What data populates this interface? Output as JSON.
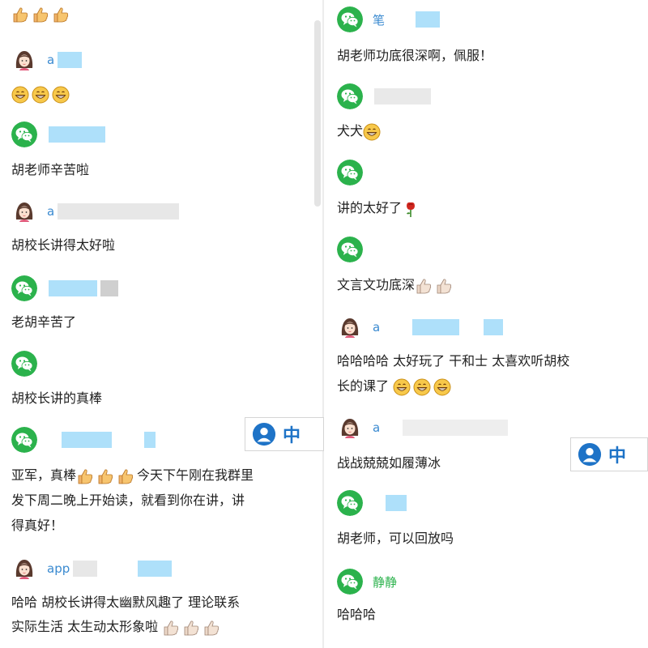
{
  "left_column": {
    "top_reaction": {
      "emoji": [
        "thumbs-up-icon",
        "thumbs-up-icon",
        "thumbs-up-icon"
      ]
    },
    "messages": [
      {
        "avatar": "girl-avatar-icon",
        "name": "a",
        "text": "",
        "emoji": [
          "grin-emoji-icon",
          "grin-emoji-icon",
          "grin-emoji-icon"
        ]
      },
      {
        "avatar": "wechat-avatar-icon",
        "name": "",
        "text": "胡老师辛苦啦"
      },
      {
        "avatar": "girl-avatar-icon",
        "name": "a",
        "text": "胡校长讲得太好啦"
      },
      {
        "avatar": "wechat-avatar-icon",
        "name": "",
        "text": "老胡辛苦了"
      },
      {
        "avatar": "wechat-avatar-icon",
        "name": "",
        "text": "胡校长讲的真棒"
      },
      {
        "avatar": "wechat-avatar-icon",
        "name": "",
        "text_before": "亚军，真棒",
        "text_after": "今天下午刚在我群里",
        "text_line2": "发下周二晚上开始读，就看到你在讲，讲",
        "text_line3": "得真好！"
      },
      {
        "avatar": "girl-avatar-icon",
        "name": "app",
        "text_line1": "哈哈 胡校长讲得太幽默风趣了 理论联系",
        "text_line2": "实际生活 太生动太形象啦"
      }
    ]
  },
  "right_column": {
    "messages": [
      {
        "avatar": "wechat-avatar-icon",
        "name": "笔",
        "text": "胡老师功底很深啊，佩服！"
      },
      {
        "avatar": "wechat-avatar-icon",
        "name": "",
        "text": "犬犬"
      },
      {
        "avatar": "wechat-avatar-icon",
        "name": "",
        "text": "讲的太好了"
      },
      {
        "avatar": "wechat-avatar-icon",
        "name": "",
        "text": "文言文功底深"
      },
      {
        "avatar": "girl-avatar-icon",
        "name": "a",
        "text_line1": "哈哈哈哈 太好玩了 干和士 太喜欢听胡校",
        "text_line2": "长的课了"
      },
      {
        "avatar": "girl-avatar-icon",
        "name": "a",
        "text": "战战兢兢如履薄冰"
      },
      {
        "avatar": "wechat-avatar-icon",
        "name": "",
        "text": "胡老师，可以回放吗"
      },
      {
        "avatar": "wechat-avatar-icon",
        "name": "静静",
        "text": "哈哈哈"
      }
    ]
  },
  "ime_toolbar": {
    "label": "中"
  },
  "colors": {
    "wechat_green": "#2bb24c",
    "name_blue": "#3a8ad0",
    "redaction": "#aee0fa",
    "text": "#222222"
  }
}
